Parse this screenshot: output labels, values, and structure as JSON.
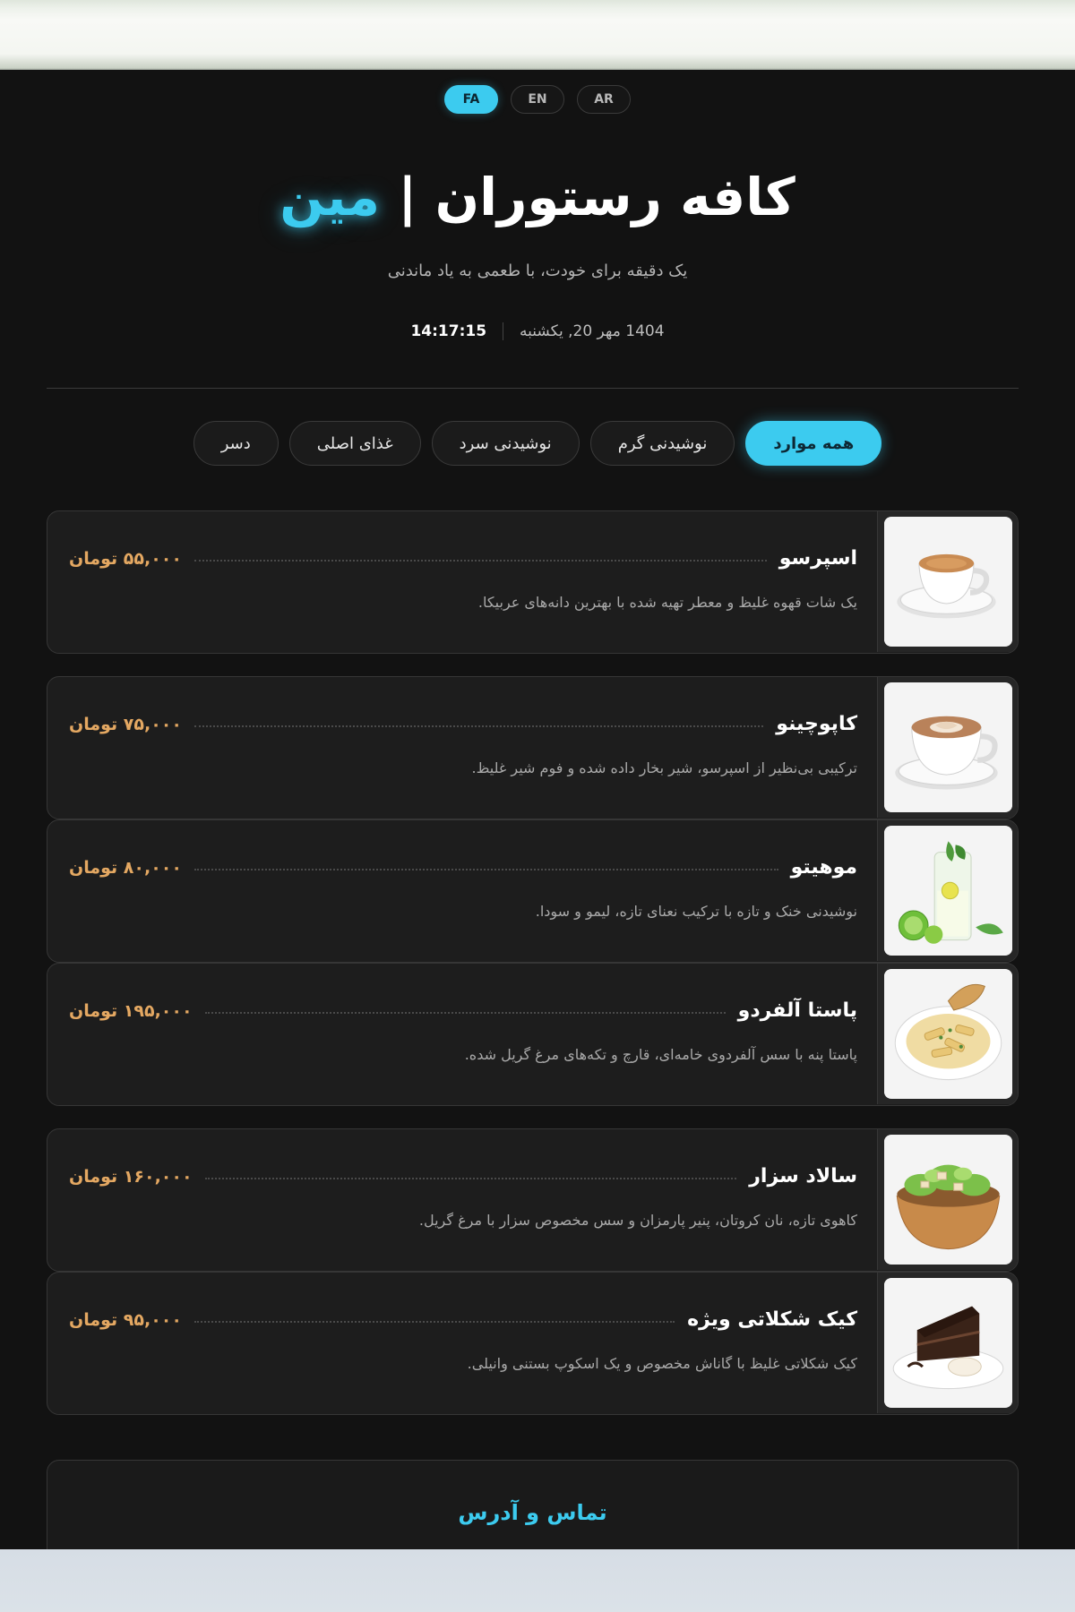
{
  "languages": [
    {
      "code": "FA",
      "active": true
    },
    {
      "code": "EN",
      "active": false
    },
    {
      "code": "AR",
      "active": false
    }
  ],
  "header": {
    "title_main": "کافه رستوران",
    "title_sep": "|",
    "title_accent": "مین",
    "subtitle": "یک دقیقه برای خودت، با طعمی به یاد ماندنی",
    "date": "1404 مهر 20, یکشنبه",
    "time": "14:17:15"
  },
  "tabs": [
    {
      "label": "همه موارد",
      "active": true
    },
    {
      "label": "نوشیدنی گرم",
      "active": false
    },
    {
      "label": "نوشیدنی سرد",
      "active": false
    },
    {
      "label": "غذای اصلی",
      "active": false
    },
    {
      "label": "دسر",
      "active": false
    }
  ],
  "menu_items": [
    {
      "name": "اسپرسو",
      "price": "۵۵,۰۰۰ تومان",
      "description": "یک شات قهوه غلیظ و معطر تهیه شده با بهترین دانه‌های عربیکا.",
      "image": "espresso-image"
    },
    {
      "name": "کاپوچینو",
      "price": "۷۵,۰۰۰ تومان",
      "description": "ترکیبی بی‌نظیر از اسپرسو، شیر بخار داده شده و فوم شیر غلیظ.",
      "image": "cappuccino-image"
    },
    {
      "name": "موهیتو",
      "price": "۸۰,۰۰۰ تومان",
      "description": "نوشیدنی خنک و تازه با ترکیب نعنای تازه، لیمو و سودا.",
      "image": "mojito-image"
    },
    {
      "name": "پاستا آلفردو",
      "price": "۱۹۵,۰۰۰ تومان",
      "description": "پاستا پنه با سس آلفردوی خامه‌ای، قارچ و تکه‌های مرغ گریل شده.",
      "image": "pasta-image"
    },
    {
      "name": "سالاد سزار",
      "price": "۱۶۰,۰۰۰ تومان",
      "description": "کاهوی تازه، نان کروتان، پنیر پارمزان و سس مخصوص سزار با مرغ گریل.",
      "image": "salad-image"
    },
    {
      "name": "کیک شکلاتی ویژه",
      "price": "۹۵,۰۰۰ تومان",
      "description": "کیک شکلاتی غلیظ با گاناش مخصوص و یک اسکوپ بستنی وانیلی.",
      "image": "cake-image"
    }
  ],
  "contact": {
    "title": "تماس و آدرس"
  },
  "colors": {
    "accent": "#3ccbef",
    "price": "#e4a862",
    "background": "#121212",
    "card": "#1d1d1d"
  }
}
